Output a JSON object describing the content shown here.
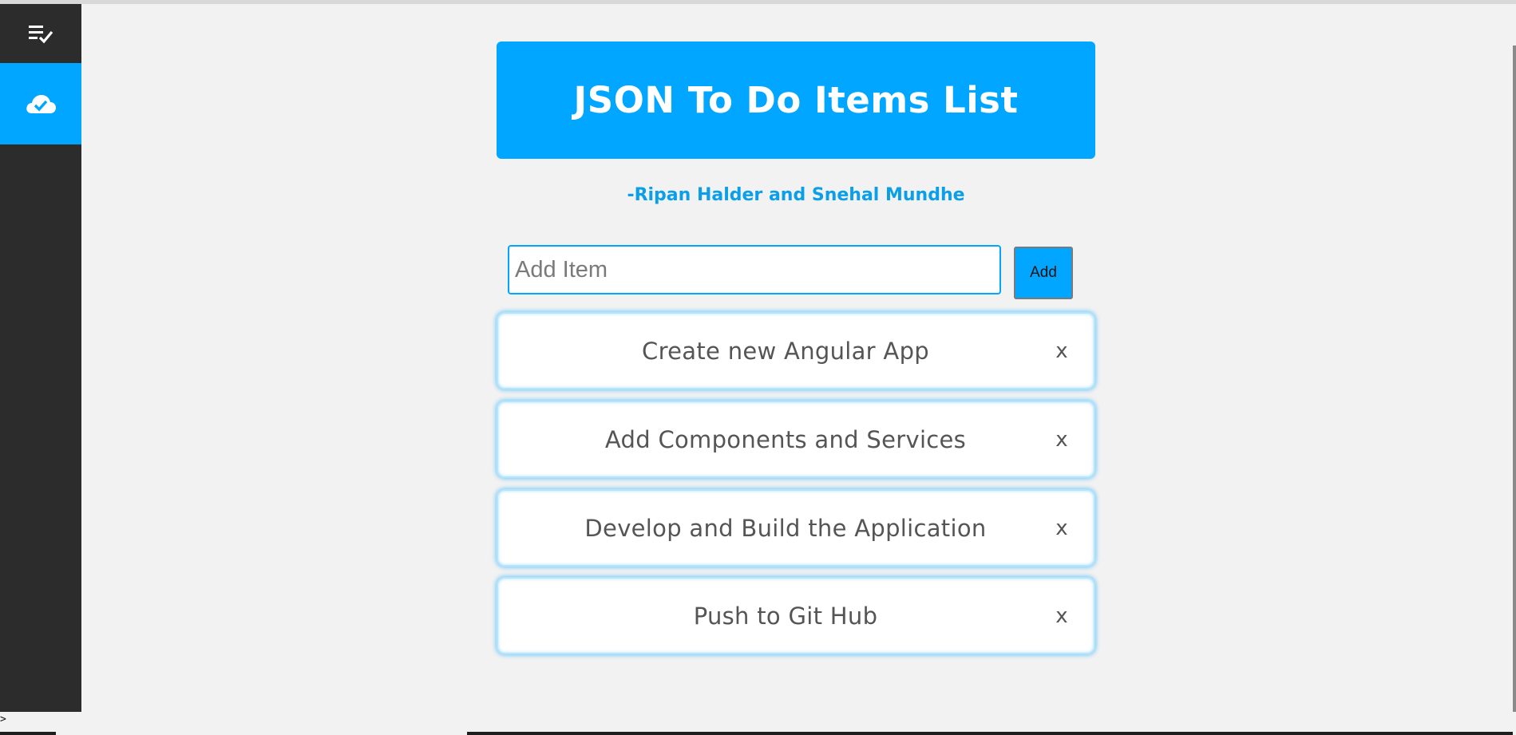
{
  "sidebar": {
    "items": [
      {
        "icon": "checklist-icon",
        "active": false
      },
      {
        "icon": "cloud-check-icon",
        "active": true
      }
    ]
  },
  "header": {
    "title": "JSON To Do Items List"
  },
  "authors": "-Ripan Halder and Snehal Mundhe",
  "add_form": {
    "placeholder": "Add Item",
    "value": "",
    "button_label": "Add"
  },
  "todos": [
    {
      "text": "Create new Angular App",
      "remove": "x"
    },
    {
      "text": "Add Components and Services",
      "remove": "x"
    },
    {
      "text": "Develop and Build the Application",
      "remove": "x"
    },
    {
      "text": "Push to Git Hub",
      "remove": "x"
    }
  ],
  "console": {
    "prompt": ">"
  },
  "colors": {
    "accent": "#00a6ff",
    "sidebar_bg": "#2c2c2c",
    "page_bg": "#f2f2f2"
  }
}
